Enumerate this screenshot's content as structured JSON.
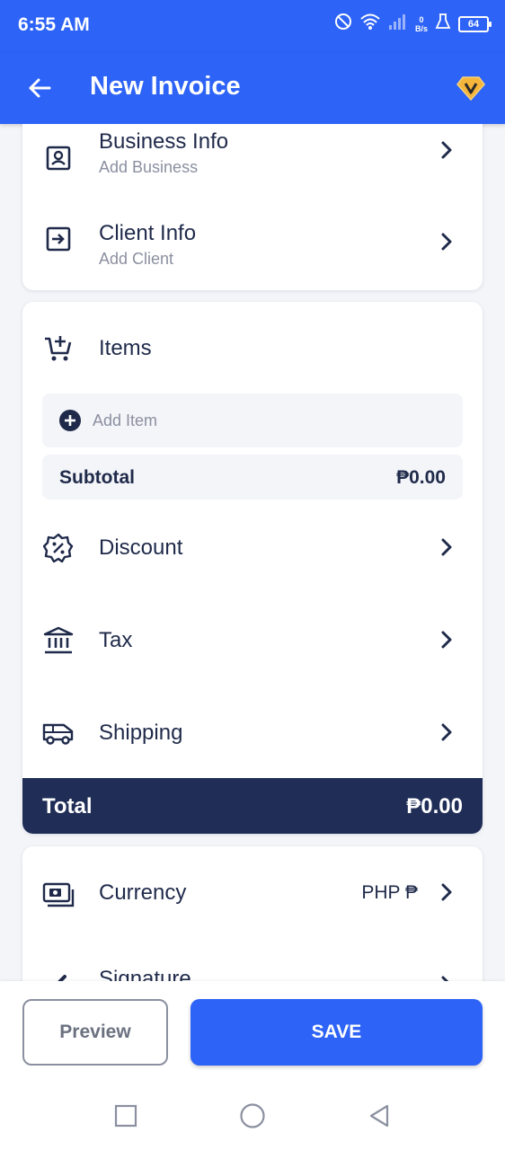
{
  "status_bar": {
    "time": "6:55 AM",
    "net_speed_value": "0",
    "net_speed_unit": "B/s",
    "battery": "64"
  },
  "app_bar": {
    "title": "New Invoice"
  },
  "info_card": {
    "business": {
      "title": "Business Info",
      "subtitle": "Add Business"
    },
    "client": {
      "title": "Client Info",
      "subtitle": "Add Client"
    }
  },
  "items_card": {
    "title": "Items",
    "add_item": "Add Item",
    "subtotal_label": "Subtotal",
    "subtotal_value": "₱0.00",
    "discount": "Discount",
    "tax": "Tax",
    "shipping": "Shipping",
    "total_label": "Total",
    "total_value": "₱0.00"
  },
  "settings_card": {
    "currency_label": "Currency",
    "currency_value": "PHP ₱",
    "signature_label": "Signature"
  },
  "bottom_bar": {
    "preview": "Preview",
    "save": "SAVE"
  },
  "colors": {
    "primary": "#2d63f6",
    "dark_navy": "#1f2d57",
    "text": "#1f2a4a",
    "muted": "#8b90a0",
    "background": "#f4f5f9",
    "premium_gold": "#f5b53a"
  }
}
